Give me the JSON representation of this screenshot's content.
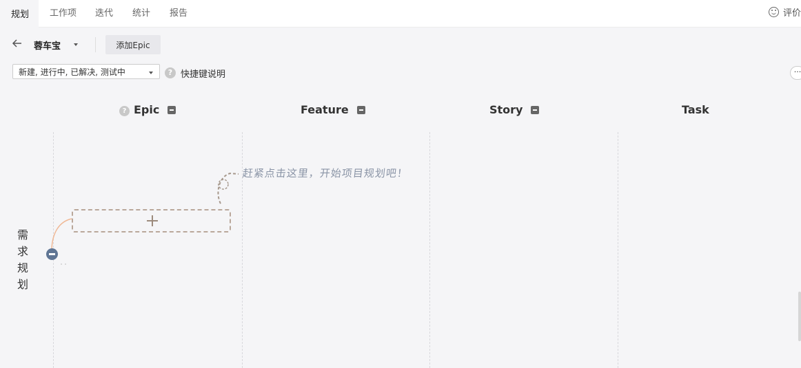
{
  "tabs": [
    {
      "label": "规划",
      "active": true
    },
    {
      "label": "工作项"
    },
    {
      "label": "迭代"
    },
    {
      "label": "统计"
    },
    {
      "label": "报告"
    }
  ],
  "feedback": {
    "label": "评价",
    "icon": "smile-icon"
  },
  "toolbar": {
    "project_name": "蓉车宝",
    "add_epic_label": "添加Epic"
  },
  "filter": {
    "selected": "新建, 进行中, 已解决, 测试中",
    "shortcut_label": "快捷键说明",
    "more_label": "···"
  },
  "columns": [
    {
      "label": "Epic",
      "collapsible": true,
      "help": true
    },
    {
      "label": "Feature",
      "collapsible": true
    },
    {
      "label": "Story",
      "collapsible": true
    },
    {
      "label": "Task",
      "collapsible": false
    }
  ],
  "lane": {
    "label": [
      "需",
      "求",
      "规",
      "划"
    ]
  },
  "hint": "赶紧点击这里，开始项目规划吧！",
  "colors": {
    "accent_line": "#f0b895",
    "dash_border": "#b9a79a",
    "lane_button": "#5f7594",
    "hint_text": "#8a94a6"
  }
}
